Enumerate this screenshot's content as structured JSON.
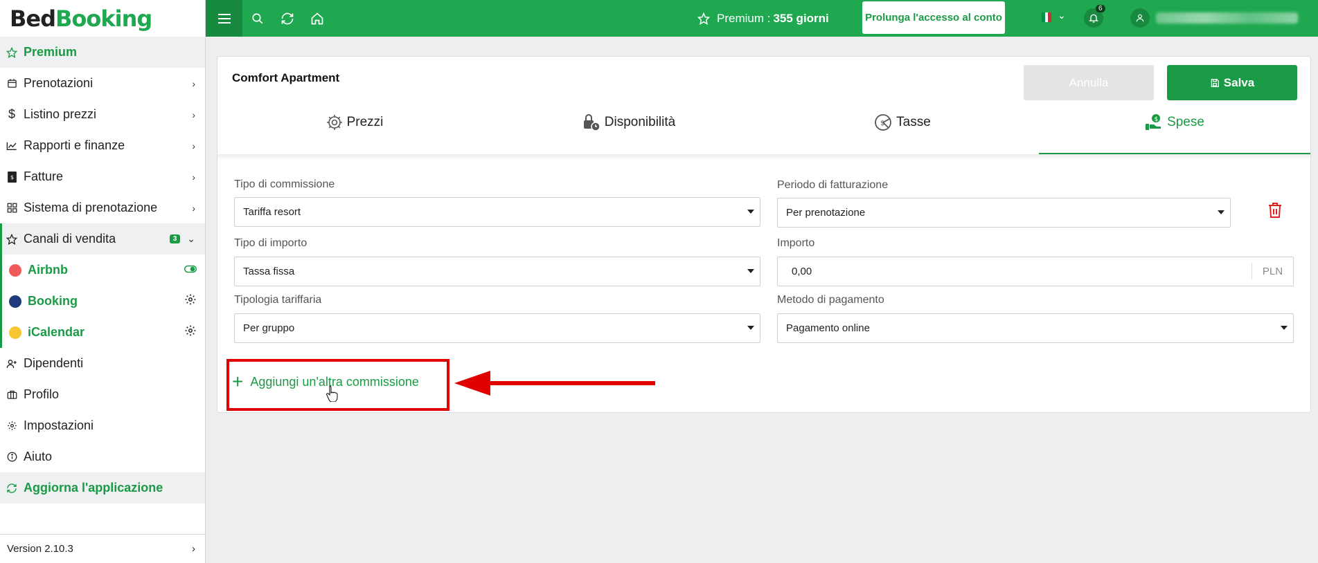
{
  "logo": {
    "part1": "Bed",
    "part2": "Booking"
  },
  "sidebar": {
    "premium": "Premium",
    "items": [
      {
        "label": "Prenotazioni",
        "icon": "calendar-icon"
      },
      {
        "label": "Listino prezzi",
        "icon": "dollar-icon"
      },
      {
        "label": "Rapporti e finanze",
        "icon": "chart-icon"
      },
      {
        "label": "Fatture",
        "icon": "invoice-icon"
      },
      {
        "label": "Sistema di prenotazione",
        "icon": "grid-icon"
      }
    ],
    "channels_label": "Canali di vendita",
    "channels_badge": "3",
    "channels": [
      {
        "name": "Airbnb",
        "color": "#f05a5a"
      },
      {
        "name": "Booking",
        "color": "#1e3a7a"
      },
      {
        "name": "iCalendar",
        "color": "#f7c531"
      }
    ],
    "bottom_items": [
      {
        "label": "Dipendenti",
        "icon": "user-add-icon"
      },
      {
        "label": "Profilo",
        "icon": "briefcase-icon"
      },
      {
        "label": "Impostazioni",
        "icon": "gear-icon"
      },
      {
        "label": "Aiuto",
        "icon": "info-icon"
      }
    ],
    "update": "Aggiorna l'applicazione",
    "version": "Version 2.10.3"
  },
  "topbar": {
    "premium_label": "Premium :",
    "premium_days": "355 giorni",
    "extend_button": "Prolunga l'accesso al conto",
    "notifications_count": "6",
    "brand_color": "#1fa84f"
  },
  "card": {
    "title": "Comfort Apartment",
    "cancel": "Annulla",
    "save": "Salva",
    "tabs": [
      {
        "label": "Prezzi",
        "icon": "gear-icon"
      },
      {
        "label": "Disponibilità",
        "icon": "lock-clock-icon"
      },
      {
        "label": "Tasse",
        "icon": "tax-icon"
      },
      {
        "label": "Spese",
        "icon": "money-hand-icon",
        "active": true
      }
    ],
    "fields": {
      "commission_type": {
        "label": "Tipo di commissione",
        "value": "Tariffa resort"
      },
      "billing_period": {
        "label": "Periodo di fatturazione",
        "value": "Per prenotazione"
      },
      "amount_type": {
        "label": "Tipo di importo",
        "value": "Tassa fissa"
      },
      "amount": {
        "label": "Importo",
        "value": "0,00",
        "unit": "PLN"
      },
      "rate_type": {
        "label": "Tipologia tariffaria",
        "value": "Per gruppo"
      },
      "payment_method": {
        "label": "Metodo di pagamento",
        "value": "Pagamento online"
      }
    },
    "add_commission": "Aggiungi un'altra commissione"
  }
}
